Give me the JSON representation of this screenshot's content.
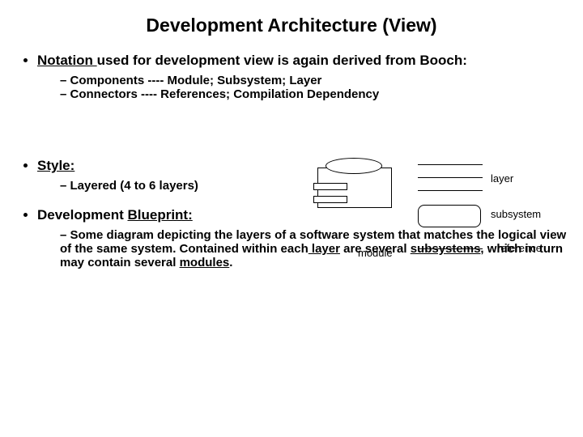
{
  "title": "Development Architecture (View)",
  "bullet1": {
    "lead_u": "Notation ",
    "lead_rest": "used for development view is again derived from Booch:",
    "sub1": "Components ---- Module; Subsystem; Layer",
    "sub2": "Connectors ---- References; Compilation Dependency"
  },
  "legend": {
    "layer": "layer",
    "subsystem": "subsystem",
    "module": "module",
    "reference": "reference"
  },
  "bullet2": {
    "label": "Style:",
    "sub1": "Layered (4 to 6 layers)"
  },
  "bullet3": {
    "lead_plain": "Development ",
    "lead_u": "Blueprint:",
    "sub_parts": {
      "p1": "Some diagram depicting the layers of a software system that matches the logical view of the same system. Contained within each",
      "u1": " layer",
      "p2": " are several ",
      "u2": "subsystems",
      "p3": ", which in turn may contain several ",
      "u3": "modules",
      "p4": "."
    }
  }
}
